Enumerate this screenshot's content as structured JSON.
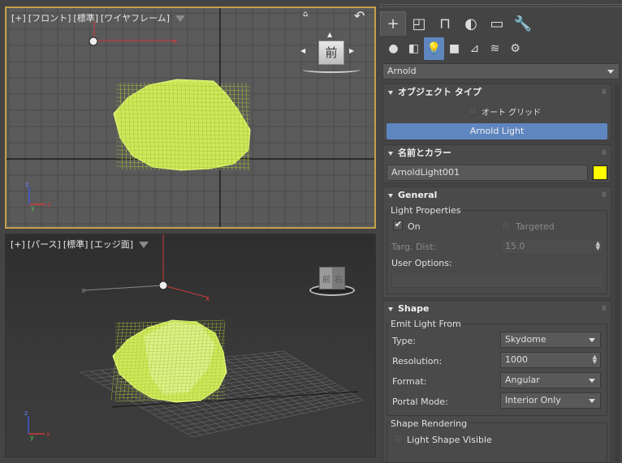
{
  "viewports": {
    "front": {
      "label_parts": [
        "[+]",
        "[フロント]",
        "[標準]",
        "[ワイヤフレーム]"
      ],
      "viewcube_face": "前"
    },
    "perspective": {
      "label_parts": [
        "[+]",
        "[パース]",
        "[標準]",
        "[エッジ面]"
      ],
      "viewcube_faces": [
        "前",
        "右"
      ]
    },
    "axis_labels": [
      "x",
      "y",
      "z"
    ]
  },
  "panel": {
    "tabs": [
      "create",
      "modify",
      "hierarchy",
      "motion",
      "display",
      "utilities"
    ],
    "tab_glyphs": [
      "+",
      "◰",
      "⊓",
      "◐",
      "▭",
      "🔧"
    ],
    "subtabs": [
      "geometry",
      "shapes",
      "lights",
      "cameras",
      "helpers",
      "space-warps",
      "systems"
    ],
    "subtab_glyphs": [
      "●",
      "◧",
      "💡",
      "■",
      "⊿",
      "≋",
      "⚙"
    ],
    "category": "Arnold",
    "object_type": {
      "title": "オブジェクト タイプ",
      "autogrid": "オート グリッド",
      "button": "Arnold Light"
    },
    "name_color": {
      "title": "名前とカラー",
      "name": "ArnoldLight001",
      "color": "#ffff00"
    },
    "general": {
      "title": "General",
      "group": "Light Properties",
      "on_label": "On",
      "targeted_label": "Targeted",
      "targ_dist_label": "Targ. Dist:",
      "targ_dist_value": "15.0",
      "user_options_label": "User Options:"
    },
    "shape": {
      "title": "Shape",
      "group": "Emit Light From",
      "type_label": "Type:",
      "type_value": "Skydome",
      "resolution_label": "Resolution:",
      "resolution_value": "1000",
      "format_label": "Format:",
      "format_value": "Angular",
      "portal_label": "Portal Mode:",
      "portal_value": "Interior Only",
      "rendering_group": "Shape Rendering",
      "visible_label": "Light Shape Visible"
    }
  },
  "colors": {
    "accent": "#5f86bf",
    "wire": "#d4f260",
    "viewport_active_border": "#c6a04a"
  }
}
